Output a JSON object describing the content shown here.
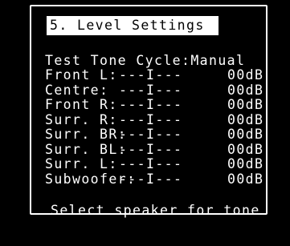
{
  "menu": {
    "title": "5. Level Settings",
    "test_tone_label": "Test Tone Cycle:",
    "test_tone_value": "Manual",
    "speakers": [
      {
        "name": "Front L:",
        "level_bar": "---I---",
        "value": "00dB"
      },
      {
        "name": "Centre:",
        "level_bar": "---I---",
        "value": "00dB"
      },
      {
        "name": "Front R:",
        "level_bar": "---I---",
        "value": "00dB"
      },
      {
        "name": "Surr. R:",
        "level_bar": "---I---",
        "value": "00dB"
      },
      {
        "name": "Surr. BR:",
        "level_bar": "---I---",
        "value": "00dB"
      },
      {
        "name": "Surr. BL:",
        "level_bar": "---I---",
        "value": "00dB"
      },
      {
        "name": "Surr. L:",
        "level_bar": "---I---",
        "value": "00dB"
      },
      {
        "name": "Subwoofer:",
        "level_bar": "---I---",
        "value": "00dB"
      }
    ],
    "footer_hint": "Select speaker for tone"
  },
  "colors": {
    "background": "#000000",
    "foreground": "#ffffff",
    "title_bg": "#ffffff",
    "title_fg": "#000000"
  }
}
